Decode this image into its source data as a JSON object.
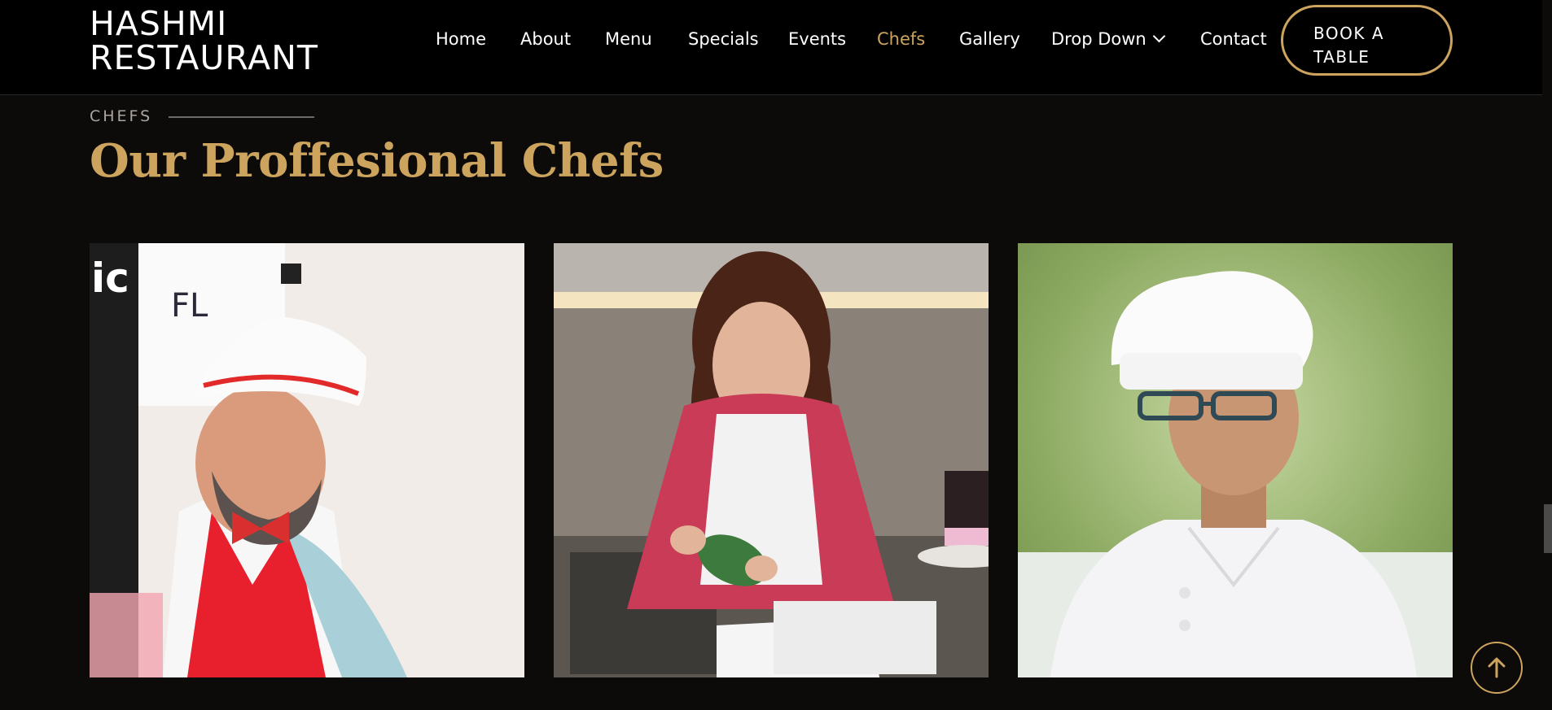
{
  "header": {
    "logo_line1": "HASHMI",
    "logo_line2": "RESTAURANT",
    "nav": [
      {
        "label": "Home"
      },
      {
        "label": "About"
      },
      {
        "label": "Menu"
      },
      {
        "label": "Specials"
      },
      {
        "label": "Events"
      },
      {
        "label": "Chefs",
        "active": true
      },
      {
        "label": "Gallery"
      },
      {
        "label": "Drop Down",
        "has_dropdown": true
      },
      {
        "label": "Contact"
      }
    ],
    "book_button_line1": "BOOK A",
    "book_button_line2": "TABLE"
  },
  "section": {
    "label": "CHEFS",
    "title": "Our Proffesional Chefs"
  },
  "chefs": [
    {
      "photo": "bearded chef with white paper hat and red apron"
    },
    {
      "photo": "female chef decorating cake with piping bag"
    },
    {
      "photo": "chef with toque and glasses"
    }
  ],
  "colors": {
    "accent": "#cda45e",
    "background": "#0c0b09",
    "header": "#000000"
  },
  "icons": {
    "back_to_top": "arrow-up-icon",
    "dropdown": "chevron-down-icon"
  }
}
